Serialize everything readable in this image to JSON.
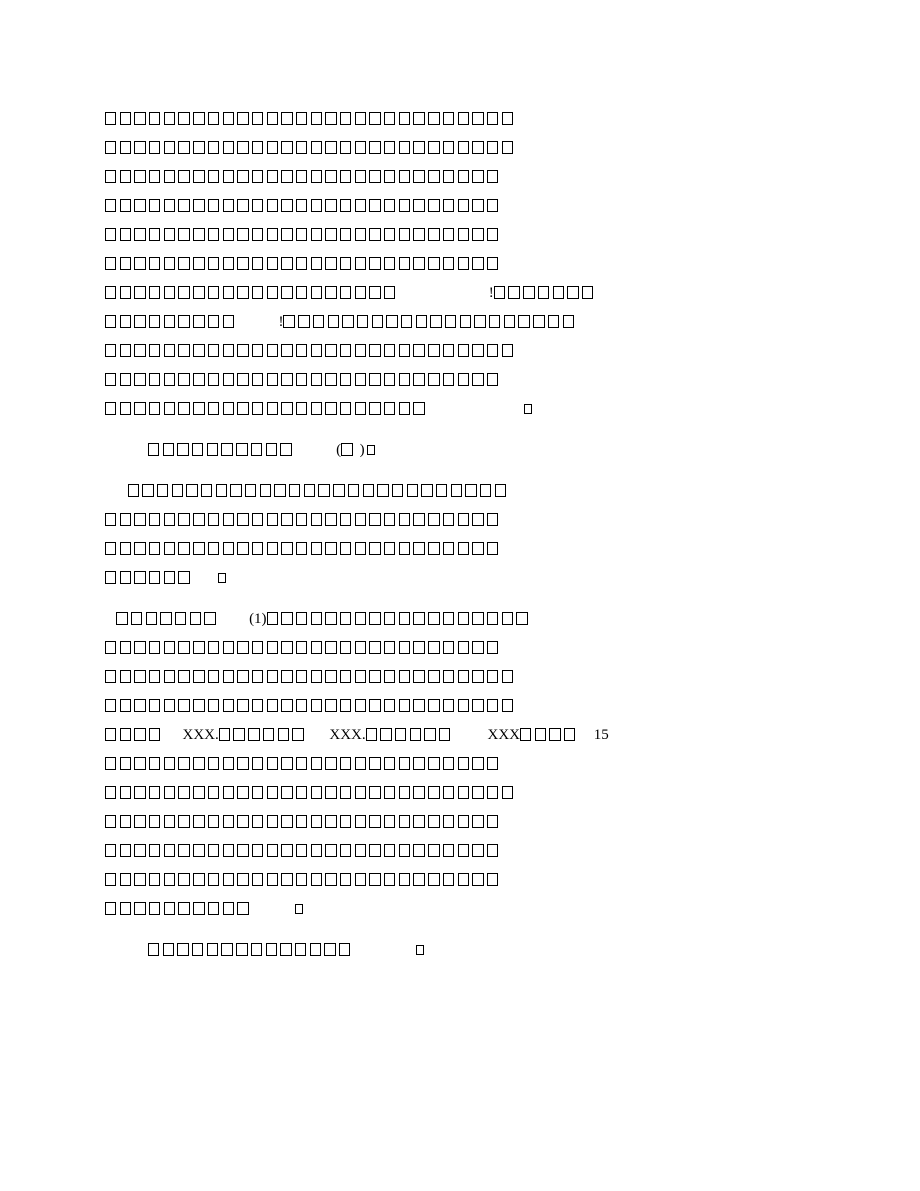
{
  "paragraphs": [
    {
      "type": "block",
      "style": "justify",
      "lines": [
        "□□□□□□□□□□□□□□□□□□□□□□□□□□□□",
        "□□□□□□□□□□□□□□□□□□□□□□□□□□□□",
        "□□□□□□□□□□□□□□□□□□□□□□□□□□□",
        "□□□□□□□□□□□□□□□□□□□□□□□□□□□",
        "□□□□□□□□□□□□□□□□□□□□□□□□□□□",
        "□□□□□□□□□□□□□□□□□□□□□□□□□□□",
        "□□□□□□□□□□□□□□□□□□□□                        !□□□□□□□",
        "□□□□□□□□□           !□□□□□□□□□□□□□□□□□□□□",
        "□□□□□□□□□□□□□□□□□□□□□□□□□□□□",
        "□□□□□□□□□□□□□□□□□□□□□□□□□□□",
        "□□□□□□□□□□□□□□□□□□□□□□                         ▫"
      ]
    },
    {
      "type": "gap"
    },
    {
      "type": "line",
      "indent": "indent1",
      "content": "□□□□□□□□□□           (□ )▫"
    },
    {
      "type": "gap"
    },
    {
      "type": "block",
      "lines": [
        "      □□□□□□□□□□□□□□□□□□□□□□□□□□",
        "□□□□□□□□□□□□□□□□□□□□□□□□□□□",
        "□□□□□□□□□□□□□□□□□□□□□□□□□□□",
        "□□□□□□      ▫"
      ]
    },
    {
      "type": "gap"
    },
    {
      "type": "block",
      "lines": [
        "   □□□□□□□        (1)□□□□□□□□□□□□□□□□□□",
        "□□□□□□□□□□□□□□□□□□□□□□□□□□□",
        "□□□□□□□□□□□□□□□□□□□□□□□□□□□□",
        "□□□□□□□□□□□□□□□□□□□□□□□□□□□□",
        "□□□□     XXX.□□□□□□      XXX.□□□□□□         XXX□□□□    15",
        "□□□□□□□□□□□□□□□□□□□□□□□□□□□",
        "□□□□□□□□□□□□□□□□□□□□□□□□□□□□",
        "□□□□□□□□□□□□□□□□□□□□□□□□□□□",
        "□□□□□□□□□□□□□□□□□□□□□□□□□□□",
        "□□□□□□□□□□□□□□□□□□□□□□□□□□□",
        "□□□□□□□□□□           ▫"
      ]
    },
    {
      "type": "gap"
    },
    {
      "type": "line",
      "indent": "indent1",
      "content": "□□□□□□□□□□□□□□                ▫"
    }
  ]
}
